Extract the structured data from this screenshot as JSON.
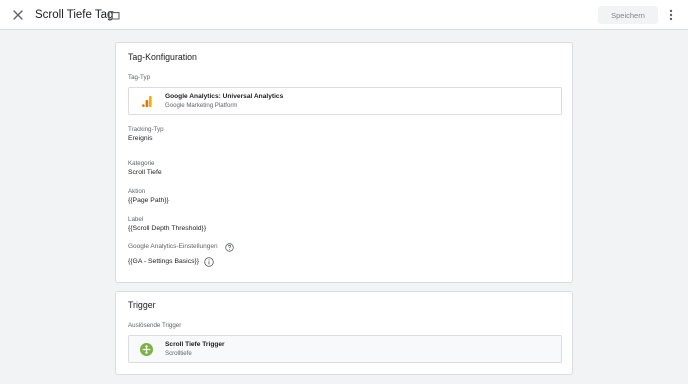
{
  "header": {
    "title": "Scroll Tiefe Tag",
    "save_label": "Speichern"
  },
  "config": {
    "title": "Tag-Konfiguration",
    "tag_type_label": "Tag-Typ",
    "tag_type_name": "Google Analytics: Universal Analytics",
    "tag_type_vendor": "Google Marketing Platform",
    "tracking_type_label": "Tracking-Typ",
    "tracking_type_value": "Ereignis",
    "category_label": "Kategorie",
    "category_value": "Scroll Tiefe",
    "action_label": "Aktion",
    "action_value": "{{Page Path}}",
    "event_label_label": "Label",
    "event_label_value": "{{Scroll Depth Threshold}}",
    "ga_settings_label": "Google Analytics-Einstellungen",
    "ga_settings_value": "{{GA - Settings Basics}}"
  },
  "trigger": {
    "title": "Trigger",
    "firing_label": "Auslösende Trigger",
    "name": "Scroll Tiefe Trigger",
    "type": "Scrolltiefe"
  },
  "colors": {
    "ga_orange": "#f9ab00",
    "ga_dark_orange": "#e37400",
    "trigger_green": "#7cb342"
  },
  "icons": {
    "close": "close-icon",
    "folder": "folder-icon",
    "more": "more-vert-icon",
    "ga": "google-analytics-icon",
    "help": "help-icon",
    "info": "info-icon",
    "trigger": "scroll-trigger-icon"
  }
}
